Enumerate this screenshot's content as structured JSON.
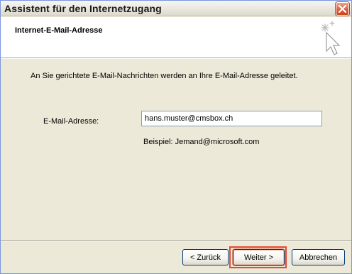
{
  "window": {
    "title": "Assistent für den Internetzugang",
    "close_icon": "close-icon"
  },
  "header": {
    "title": "Internet-E-Mail-Adresse",
    "icon": "wizard-cursor-icon"
  },
  "content": {
    "intro": "An Sie gerichtete E-Mail-Nachrichten werden an Ihre E-Mail-Adresse geleitet.",
    "email_label": "E-Mail-Adresse:",
    "email_value": "hans.muster@cmsbox.ch",
    "example": "Beispiel: Jemand@microsoft.com"
  },
  "buttons": {
    "back": "< Zurück",
    "next": "Weiter >",
    "cancel": "Abbrechen"
  },
  "colors": {
    "title_bar": "#e9e7de",
    "close_button": "#d9633f",
    "highlight": "#e24a33"
  }
}
